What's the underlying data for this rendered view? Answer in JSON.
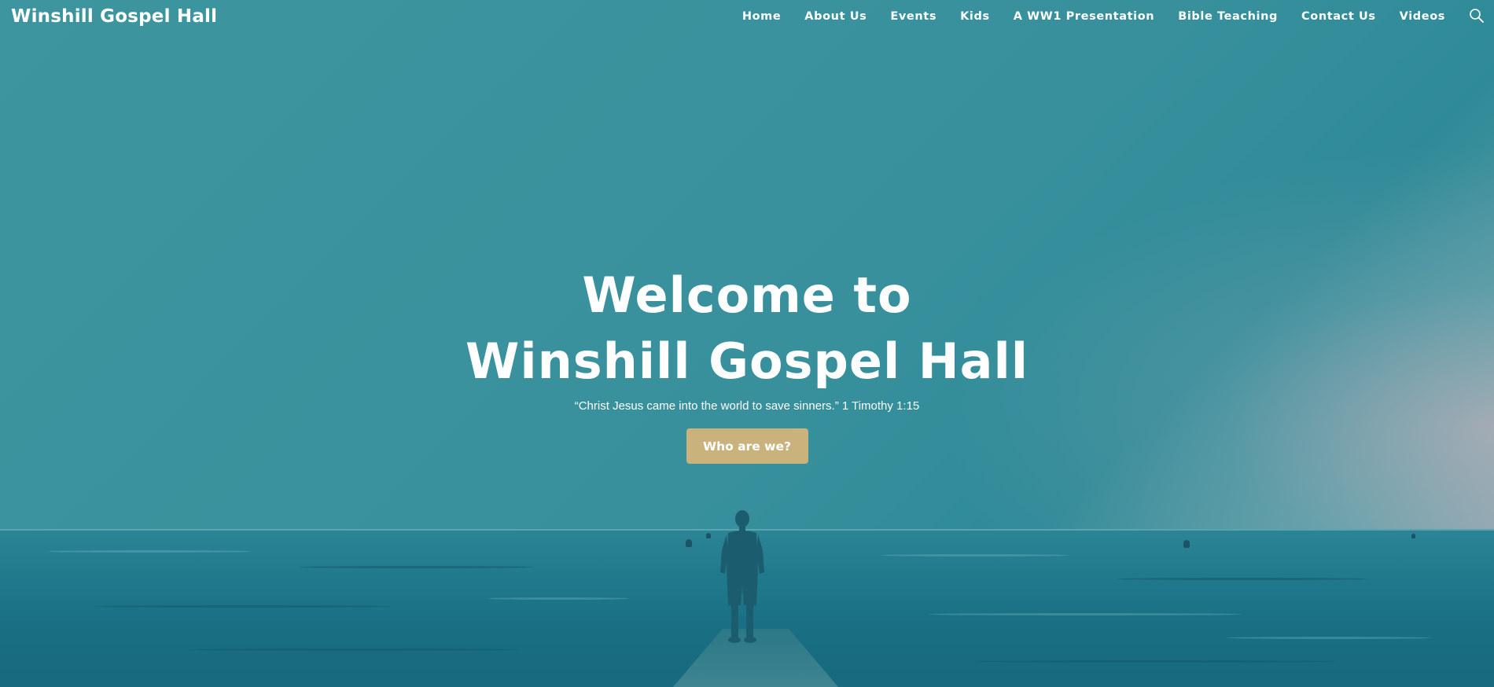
{
  "site": {
    "brand": "Winshill Gospel Hall"
  },
  "nav": {
    "items": [
      {
        "label": "Home"
      },
      {
        "label": "About Us"
      },
      {
        "label": "Events"
      },
      {
        "label": "Kids"
      },
      {
        "label": "A WW1 Presentation"
      },
      {
        "label": "Bible Teaching"
      },
      {
        "label": "Contact Us"
      },
      {
        "label": "Videos"
      }
    ],
    "search_icon": "search-icon"
  },
  "hero": {
    "title_line1": "Welcome to",
    "title_line2": "Winshill Gospel Hall",
    "verse": "“Christ Jesus came into the world to save sinners.”  1 Timothy 1:15",
    "button_label": "Who are we?",
    "background_image": "man-standing-on-pier-facing-sea-photo"
  },
  "colors": {
    "overlay": "#3a939e",
    "button": "#c9b27c",
    "text": "#ffffff"
  }
}
